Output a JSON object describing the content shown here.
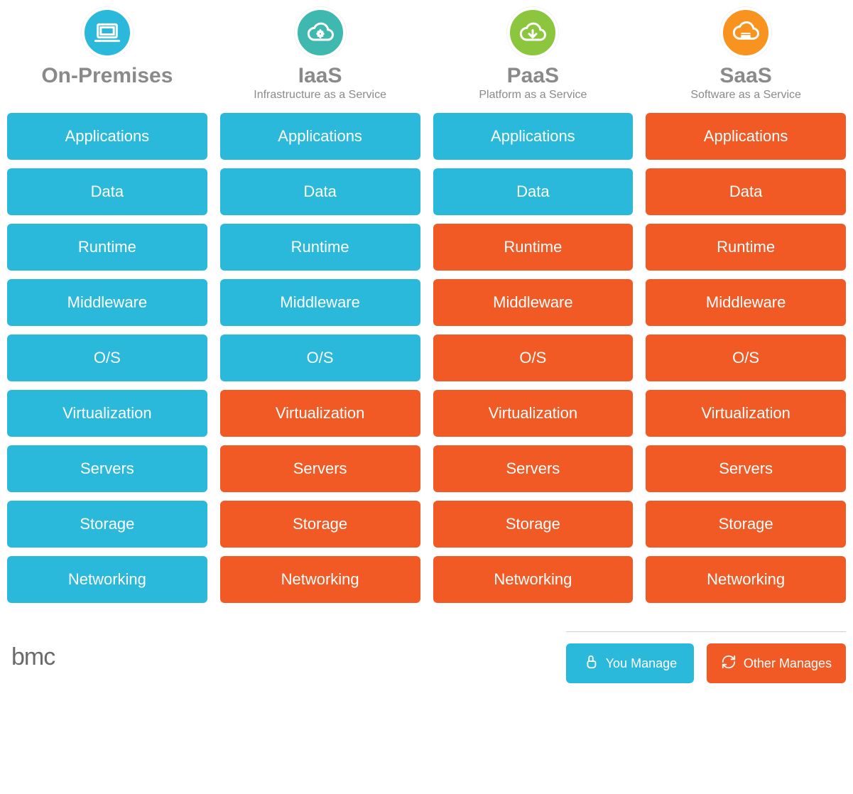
{
  "colors": {
    "you": "#2ab9da",
    "other": "#f15a24",
    "onprem_icon_bg": "#2ab9da",
    "iaas_icon_bg": "#3fb8af",
    "paas_icon_bg": "#8cc63f",
    "saas_icon_bg": "#f7931e"
  },
  "columns": [
    {
      "id": "onprem",
      "title": "On-Premises",
      "subtitle": "",
      "icon": "laptop-icon",
      "managed_by": [
        "you",
        "you",
        "you",
        "you",
        "you",
        "you",
        "you",
        "you",
        "you"
      ]
    },
    {
      "id": "iaas",
      "title": "IaaS",
      "subtitle": "Infrastructure as a Service",
      "icon": "cloud-gear-icon",
      "managed_by": [
        "you",
        "you",
        "you",
        "you",
        "you",
        "other",
        "other",
        "other",
        "other"
      ]
    },
    {
      "id": "paas",
      "title": "PaaS",
      "subtitle": "Platform as a Service",
      "icon": "cloud-download-icon",
      "managed_by": [
        "you",
        "you",
        "other",
        "other",
        "other",
        "other",
        "other",
        "other",
        "other"
      ]
    },
    {
      "id": "saas",
      "title": "SaaS",
      "subtitle": "Software as a Service",
      "icon": "cloud-browser-icon",
      "managed_by": [
        "other",
        "other",
        "other",
        "other",
        "other",
        "other",
        "other",
        "other",
        "other"
      ]
    }
  ],
  "layers": [
    "Applications",
    "Data",
    "Runtime",
    "Middleware",
    "O/S",
    "Virtualization",
    "Servers",
    "Storage",
    "Networking"
  ],
  "legend": {
    "you": "You Manage",
    "other": "Other Manages"
  },
  "brand": "bmc"
}
